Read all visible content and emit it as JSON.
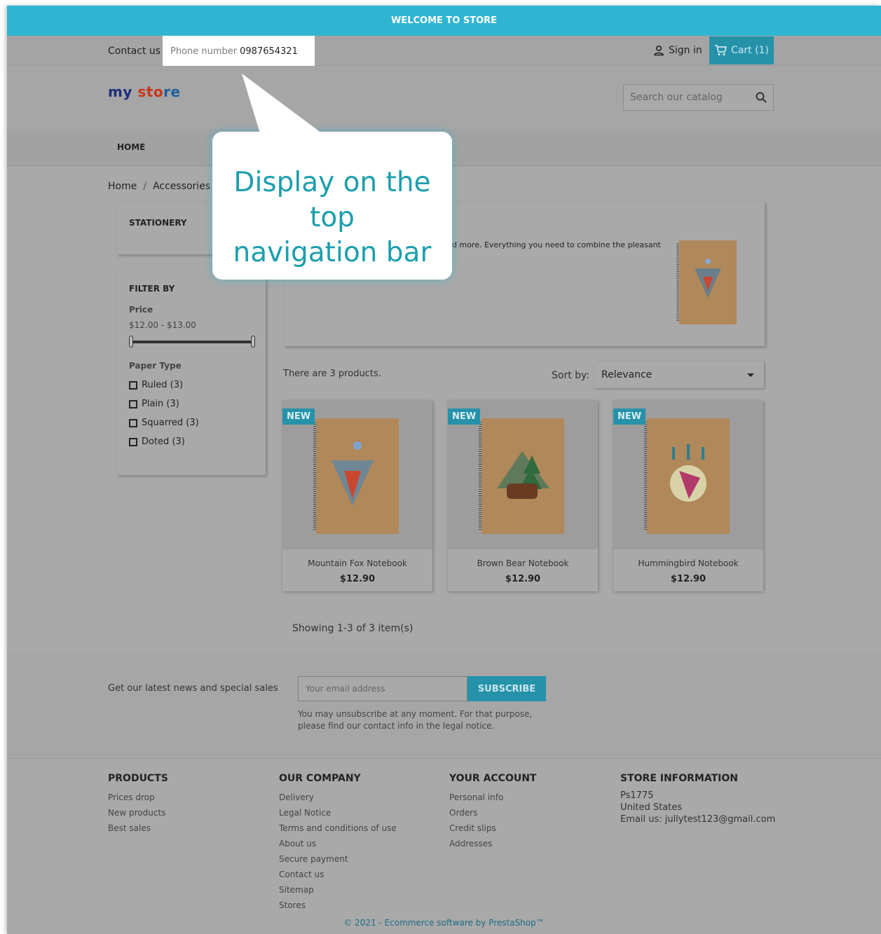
{
  "banner": {
    "text": "WELCOME TO STORE"
  },
  "topnav": {
    "contact": "Contact us",
    "phone_label": "Phone number",
    "phone_number": "0987654321",
    "signin": "Sign in",
    "cart": "Cart (1)"
  },
  "header": {
    "logo_part1": "my",
    "logo_part2": "sto",
    "logo_part3": "re",
    "search_placeholder": "Search our catalog"
  },
  "menu": {
    "home": "HOME"
  },
  "breadcrumb": {
    "items": [
      "Home",
      "Accessories"
    ],
    "separator": "/"
  },
  "sidebar": {
    "category_title": "STATIONERY",
    "filter_title": "FILTER BY",
    "price_label": "Price",
    "price_range": "$12.00 - $13.00",
    "price_slider_fraction": [
      0,
      1
    ],
    "paper_label": "Paper Type",
    "paper_options": [
      "Ruled (3)",
      "Plain (3)",
      "Squarred (3)",
      "Doted (3)"
    ]
  },
  "category_description": "d more. Everything you need to combine the pleasant",
  "listing": {
    "count": "There are 3 products.",
    "sort_label": "Sort by:",
    "sort_value": "Relevance",
    "showing": "Showing 1-3 of 3 item(s)"
  },
  "products": [
    {
      "badge": "NEW",
      "name": "Mountain Fox Notebook",
      "price": "$12.90"
    },
    {
      "badge": "NEW",
      "name": "Brown Bear Notebook",
      "price": "$12.90"
    },
    {
      "badge": "NEW",
      "name": "Hummingbird Notebook",
      "price": "$12.90"
    }
  ],
  "newsletter": {
    "label": "Get our latest news and special sales",
    "placeholder": "Your email address",
    "button": "SUBSCRIBE",
    "note_line1": "You may unsubscribe at any moment. For that purpose,",
    "note_line2": "please find our contact info in the legal notice."
  },
  "footer": {
    "products_title": "PRODUCTS",
    "products_links": [
      "Prices drop",
      "New products",
      "Best sales"
    ],
    "company_title": "OUR COMPANY",
    "company_links": [
      "Delivery",
      "Legal Notice",
      "Terms and conditions of use",
      "About us",
      "Secure payment",
      "Contact us",
      "Sitemap",
      "Stores"
    ],
    "account_title": "YOUR ACCOUNT",
    "account_links": [
      "Personal info",
      "Orders",
      "Credit slips",
      "Addresses"
    ],
    "store_title": "STORE INFORMATION",
    "store_lines": [
      "Ps1775",
      "United States",
      "Email us: jullytest123@gmail.com"
    ],
    "copyright": "© 2021 - Ecommerce software by PrestaShop™"
  },
  "callout": {
    "line1": "Display on the top",
    "line2": "navigation bar"
  },
  "colors": {
    "accent": "#2fb5d2",
    "accent_dark": "#2592a9",
    "callout_text": "#1c9fad"
  }
}
